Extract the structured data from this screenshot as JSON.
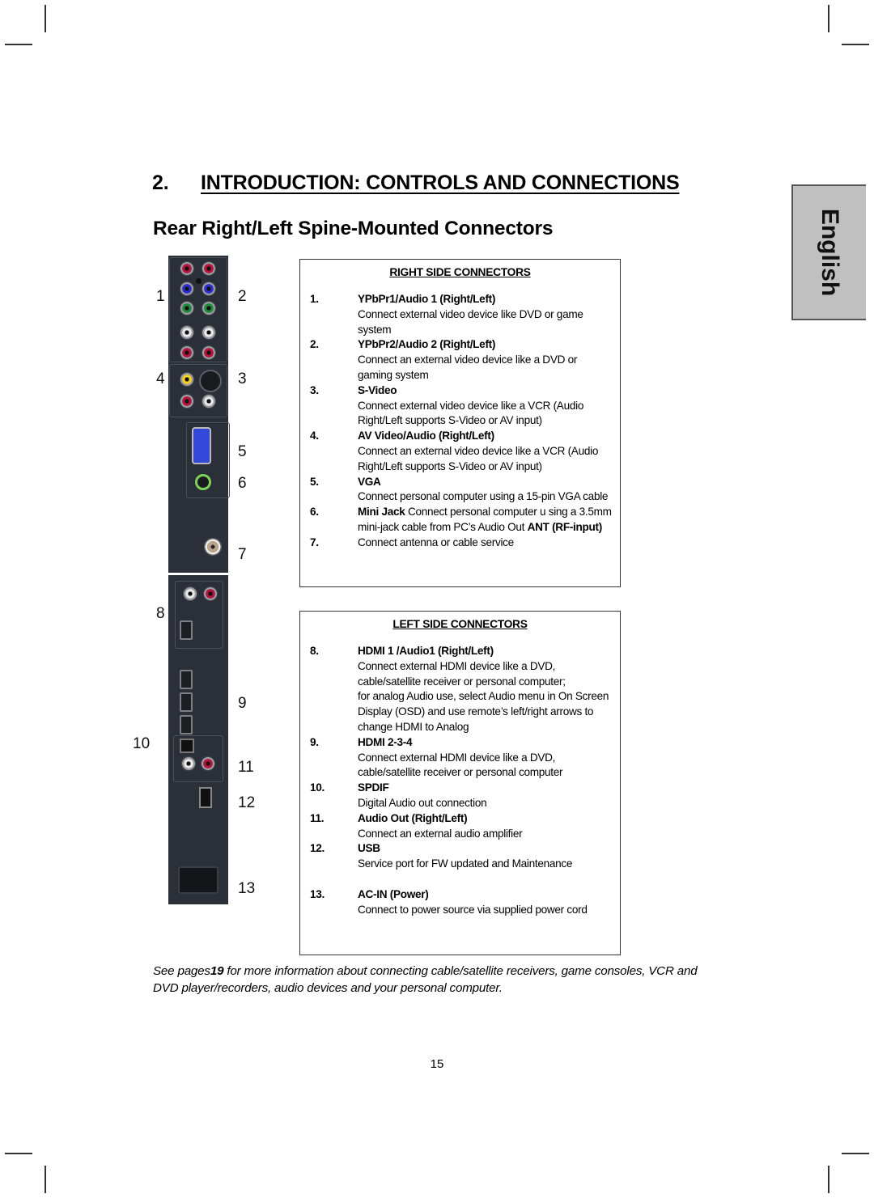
{
  "chapter": {
    "number": "2.",
    "title": "INTRODUCTION: CONTROLS AND CONNECTIONS"
  },
  "section_title": "Rear Right/Left Spine-Mounted Connectors",
  "language_tab": "English",
  "panel_callouts": [
    "1",
    "2",
    "4",
    "3",
    "5",
    "6",
    "7",
    "8",
    "9",
    "10",
    "11",
    "12",
    "13"
  ],
  "right_box": {
    "title": "RIGHT SIDE CONNECTORS",
    "items": [
      {
        "num": "1.",
        "heading": "YPbPr1/Audio 1 (Right/Left)",
        "desc": "Connect external video device like DVD or game system"
      },
      {
        "num": "2.",
        "heading": "YPbPr2/Audio 2 (Right/Left)",
        "desc": "Connect an external video device like a DVD or gaming system"
      },
      {
        "num": "3.",
        "heading": "S-Video",
        "desc": "Connect external video device like a VCR (Audio Right/Left supports S-Video or AV input)"
      },
      {
        "num": "4.",
        "heading": "AV Video/Audio (Right/Left)",
        "desc": "Connect an external video device like a VCR (Audio Right/Left supports S-Video or AV input)"
      },
      {
        "num": "5.",
        "heading": "VGA",
        "desc": "Connect personal computer using a 15-pin VGA cable"
      },
      {
        "num": "6.",
        "heading": "Mini Jack",
        "desc": "Connect personal computer u sing a 3.5mm mini-jack cable from PC’s Audio Out",
        "trailing_bold": "ANT (RF-input)"
      },
      {
        "num": "7.",
        "heading": "",
        "desc": "Connect antenna or cable service"
      }
    ]
  },
  "left_box": {
    "title": "LEFT SIDE CONNECTORS",
    "items": [
      {
        "num": "8.",
        "heading": "HDMI 1 /Audio1 (Right/Left)",
        "desc": "Connect external HDMI device like a DVD, cable/satellite receiver or personal computer;",
        "desc2": "for analog Audio use, select Audio menu in On Screen Display (OSD) and use remote’s left/right arrows to change HDMI to Analog"
      },
      {
        "num": "9.",
        "heading": "HDMI 2-3-4",
        "desc": "Connect external HDMI device like a DVD, cable/satellite receiver or personal computer"
      },
      {
        "num": "10.",
        "heading": "SPDIF",
        "desc": "Digital Audio out connection"
      },
      {
        "num": "11.",
        "heading": "Audio Out (Right/Left)",
        "desc": "Connect an external audio amplifier"
      },
      {
        "num": "12.",
        "heading": "USB",
        "desc": "Service port for FW updated and Maintenance"
      },
      {
        "num": "13.",
        "heading": "AC-IN (Power)",
        "desc": "Connect to power source via supplied power cord"
      }
    ]
  },
  "footnote": {
    "prefix": "See pages",
    "page_ref": "19",
    "suffix": " for more information about connecting cable/satellite receivers, game consoles, VCR and DVD player/recorders, audio devices and your personal computer."
  },
  "page_number": "15"
}
